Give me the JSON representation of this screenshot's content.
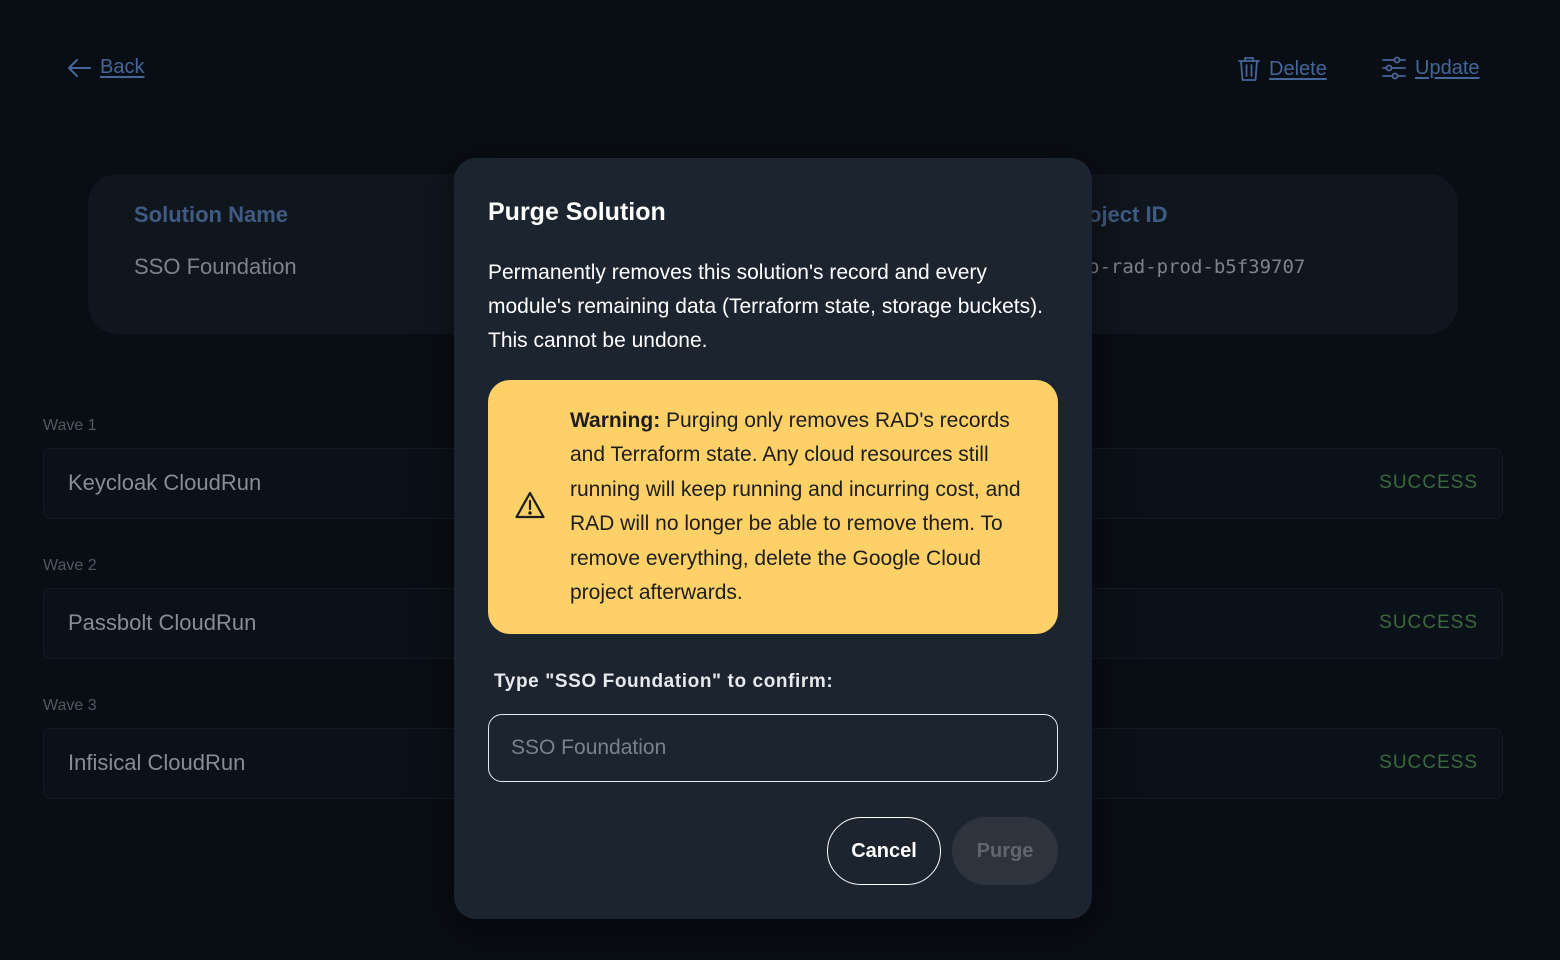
{
  "topbar": {
    "back_label": "Back",
    "delete_label": "Delete",
    "update_label": "Update"
  },
  "info": {
    "solution_name_label": "Solution Name",
    "solution_name_value": "SSO Foundation",
    "project_id_label": "oject ID",
    "project_id_value": "o-rad-prod-b5f39707"
  },
  "waves": [
    {
      "label": "Wave 1",
      "module": "Keycloak CloudRun",
      "status": "SUCCESS"
    },
    {
      "label": "Wave 2",
      "module": "Passbolt CloudRun",
      "status": "SUCCESS"
    },
    {
      "label": "Wave 3",
      "module": "Infisical CloudRun",
      "status": "SUCCESS"
    }
  ],
  "modal": {
    "title": "Purge Solution",
    "description": "Permanently removes this solution's record and every module's remaining data (Terraform state, storage buckets). This cannot be undone.",
    "warning_prefix": "Warning:",
    "warning_text": " Purging only removes RAD's records and Terraform state. Any cloud resources still running will keep running and incurring cost, and RAD will no longer be able to remove them. To remove everything, delete the Google Cloud project afterwards.",
    "confirm_label": "Type \"SSO Foundation\" to confirm:",
    "confirm_placeholder": "SSO Foundation",
    "cancel_label": "Cancel",
    "purge_label": "Purge"
  },
  "colors": {
    "accent_link": "#5a86c8",
    "warning_bg": "#fdd068",
    "success": "#4f8a4f",
    "modal_bg": "#1c242f"
  },
  "icons": [
    "arrow-left-icon",
    "trash-icon",
    "sliders-icon",
    "warning-triangle-icon"
  ]
}
